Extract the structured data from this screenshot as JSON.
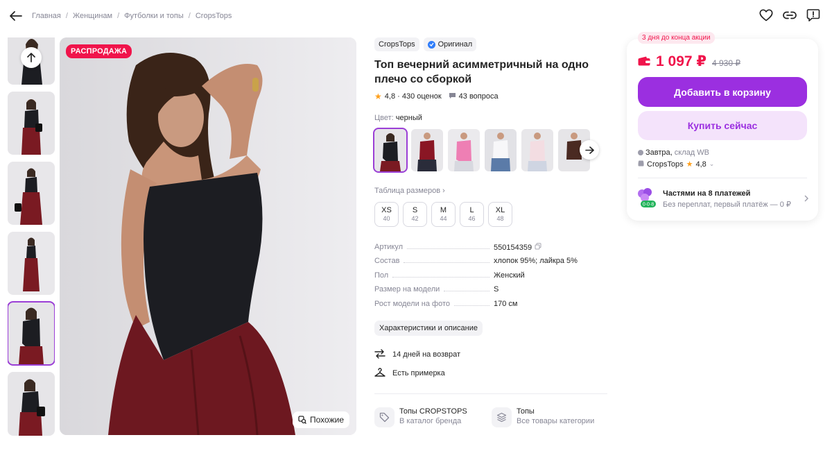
{
  "breadcrumbs": [
    "Главная",
    "Женщинам",
    "Футболки и топы",
    "CropsTops"
  ],
  "header_icons": [
    "heart-icon",
    "link-icon",
    "report-icon"
  ],
  "gallery": {
    "sale_badge": "РАСПРОДАЖА",
    "similar_label": "Похожие",
    "thumbnail_count": 6,
    "selected_thumbnail": 4
  },
  "product": {
    "brand": "CropsTops",
    "original_label": "Оригинал",
    "title": "Топ вечерний асимметричный на одно плечо со сборкой",
    "rating": "4,8",
    "reviews": "430 оценок",
    "rating_text": "4,8 · 430 оценок",
    "questions": "43 вопроса",
    "color_label": "Цвет:",
    "color_value": "черный",
    "swatch_colors": [
      "#1c1d22",
      "#8a1624",
      "#ee7fb4",
      "#f4f4f6",
      "#f3dde2",
      "#4a2a22"
    ],
    "size_table_label": "Таблица размеров ›",
    "sizes": [
      {
        "name": "XS",
        "num": "40"
      },
      {
        "name": "S",
        "num": "42"
      },
      {
        "name": "M",
        "num": "44"
      },
      {
        "name": "L",
        "num": "46"
      },
      {
        "name": "XL",
        "num": "48"
      }
    ],
    "specs": [
      {
        "key": "Артикул",
        "value": "550154359"
      },
      {
        "key": "Состав",
        "value": "хлопок 95%; лайкра 5%"
      },
      {
        "key": "Пол",
        "value": "Женский"
      },
      {
        "key": "Размер на модели",
        "value": "S"
      },
      {
        "key": "Рост модели на фото",
        "value": "170 см"
      }
    ],
    "desc_button": "Характеристики и описание",
    "perks": [
      "14 дней на возврат",
      "Есть примерка"
    ],
    "categories": [
      {
        "title": "Топы CROPSTOPS",
        "sub": "В каталог бренда"
      },
      {
        "title": "Топы",
        "sub": "Все товары категории"
      }
    ]
  },
  "buy": {
    "deal_badge": "3 дня до конца акции",
    "price": "1 097 ₽",
    "old_price": "4 930 ₽",
    "cart_button": "Добавить в корзину",
    "buy_button": "Купить сейчас",
    "delivery_day": "Завтра,",
    "delivery_where": "склад WB",
    "seller": "CropsTops",
    "seller_rating": "4,8",
    "installments_title": "Частями на 8 платежей",
    "installments_sub": "Без переплат, первый платёж — 0 ₽",
    "installments_badge": "0·0·8"
  },
  "colors": {
    "accent": "#9b2fe0",
    "price": "#f0144b",
    "star": "#ff9f1a"
  }
}
